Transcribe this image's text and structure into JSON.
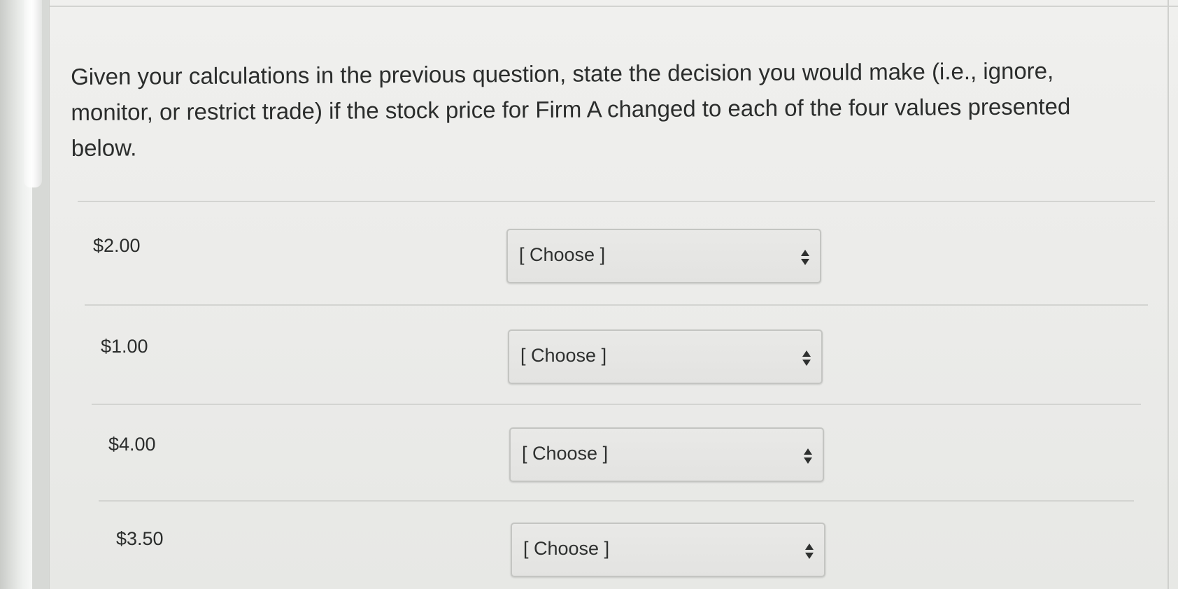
{
  "question": {
    "text": "Given your calculations in the previous question, state the decision you would make (i.e., ignore, monitor, or restrict trade) if the stock price for Firm A changed to each of the four values presented below."
  },
  "answers": [
    {
      "price": "$2.00",
      "select_value": "[ Choose ]",
      "icon": "updown-chevron-icon"
    },
    {
      "price": "$1.00",
      "select_value": "[ Choose ]",
      "icon": "updown-chevron-icon"
    },
    {
      "price": "$4.00",
      "select_value": "[ Choose ]",
      "icon": "updown-chevron-icon"
    },
    {
      "price": "$3.50",
      "select_value": "[ Choose ]",
      "icon": "updown-chevron-icon"
    }
  ]
}
